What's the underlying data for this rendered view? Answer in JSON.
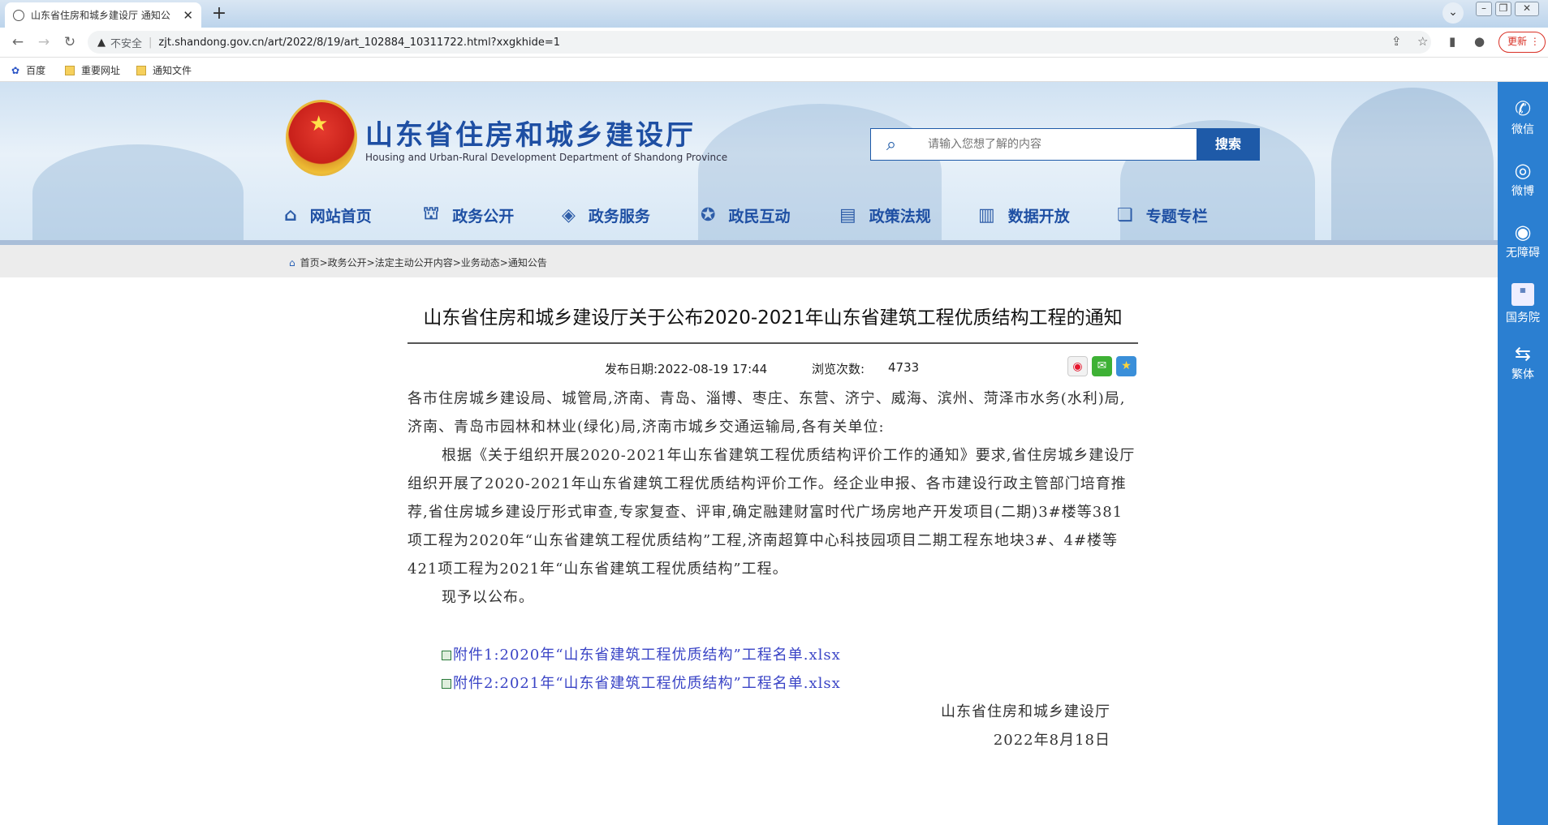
{
  "browser": {
    "tab_title": "山东省住房和城乡建设厅 通知公",
    "insecure_label": "不安全",
    "url": "zjt.shandong.gov.cn/art/2022/8/19/art_102884_10311722.html?xxgkhide=1",
    "update_label": "更新",
    "bookmarks": [
      "百度",
      "重要网址",
      "通知文件"
    ]
  },
  "header": {
    "site_title": "山东省住房和城乡建设厅",
    "site_subtitle": "Housing and Urban-Rural Development Department of Shandong Province",
    "search_placeholder": "请输入您想了解的内容",
    "search_button": "搜索"
  },
  "nav": [
    {
      "label": "网站首页",
      "icon": "home-icon"
    },
    {
      "label": "政务公开",
      "icon": "building-icon"
    },
    {
      "label": "政务服务",
      "icon": "service-icon"
    },
    {
      "label": "政民互动",
      "icon": "interaction-icon"
    },
    {
      "label": "政策法规",
      "icon": "document-icon"
    },
    {
      "label": "数据开放",
      "icon": "data-icon"
    },
    {
      "label": "专题专栏",
      "icon": "topic-icon"
    }
  ],
  "breadcrumb": "首页>政务公开>法定主动公开内容>业务动态>通知公告",
  "article": {
    "title": "山东省住房和城乡建设厅关于公布2020-2021年山东省建筑工程优质结构工程的通知",
    "date": "发布日期:2022-08-19 17:44",
    "views_label": "浏览次数:",
    "views": "4733",
    "salutation": "各市住房城乡建设局、城管局,济南、青岛、淄博、枣庄、东营、济宁、威海、滨州、菏泽市水务(水利)局,济南、青岛市园林和林业(绿化)局,济南市城乡交通运输局,各有关单位:",
    "para1": "根据《关于组织开展2020-2021年山东省建筑工程优质结构评价工作的通知》要求,省住房城乡建设厅组织开展了2020-2021年山东省建筑工程优质结构评价工作。经企业申报、各市建设行政主管部门培育推荐,省住房城乡建设厅形式审查,专家复查、评审,确定融建财富时代广场房地产开发项目(二期)3#楼等381项工程为2020年“山东省建筑工程优质结构”工程,济南超算中心科技园项目二期工程东地块3#、4#楼等421项工程为2021年“山东省建筑工程优质结构”工程。",
    "para2": "现予以公布。",
    "attachments": [
      "附件1:2020年“山东省建筑工程优质结构”工程名单.xlsx",
      "附件2:2021年“山东省建筑工程优质结构”工程名单.xlsx"
    ],
    "signature": "山东省住房和城乡建设厅",
    "sign_date": "2022年8月18日"
  },
  "sidebar": [
    "微信",
    "微博",
    "无障碍",
    "国务院",
    "繁体"
  ]
}
